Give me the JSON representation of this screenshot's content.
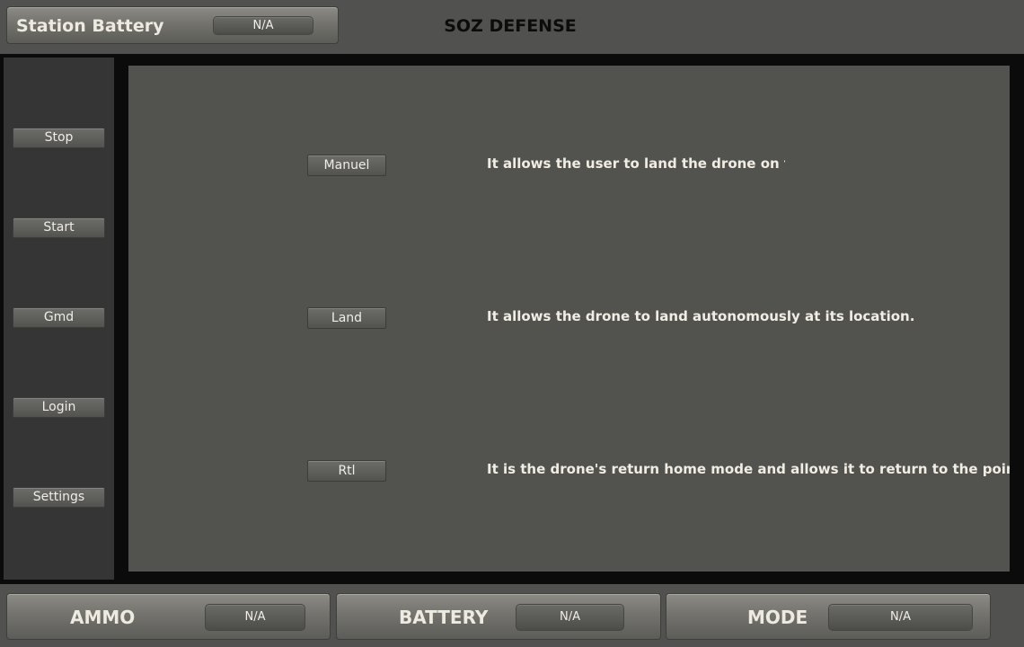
{
  "header": {
    "station_battery_label": "Station Battery",
    "station_battery_value": "N/A",
    "title": "SOZ DEFENSE"
  },
  "sidebar": {
    "items": [
      {
        "label": "Stop"
      },
      {
        "label": "Start"
      },
      {
        "label": "Gmd"
      },
      {
        "label": "Login"
      },
      {
        "label": "Settings"
      }
    ]
  },
  "modes": [
    {
      "label": "Manuel",
      "description": "It allows the user to land the drone on the g"
    },
    {
      "label": "Land",
      "description": "It allows the drone to land autonomously at its location."
    },
    {
      "label": "Rtl",
      "description": "It is the drone's return home mode and allows it to return to the point where"
    }
  ],
  "footer": {
    "ammo": {
      "label": "AMMO",
      "value": "N/A"
    },
    "battery": {
      "label": "BATTERY",
      "value": "N/A"
    },
    "mode": {
      "label": "MODE",
      "value": "N/A"
    }
  }
}
